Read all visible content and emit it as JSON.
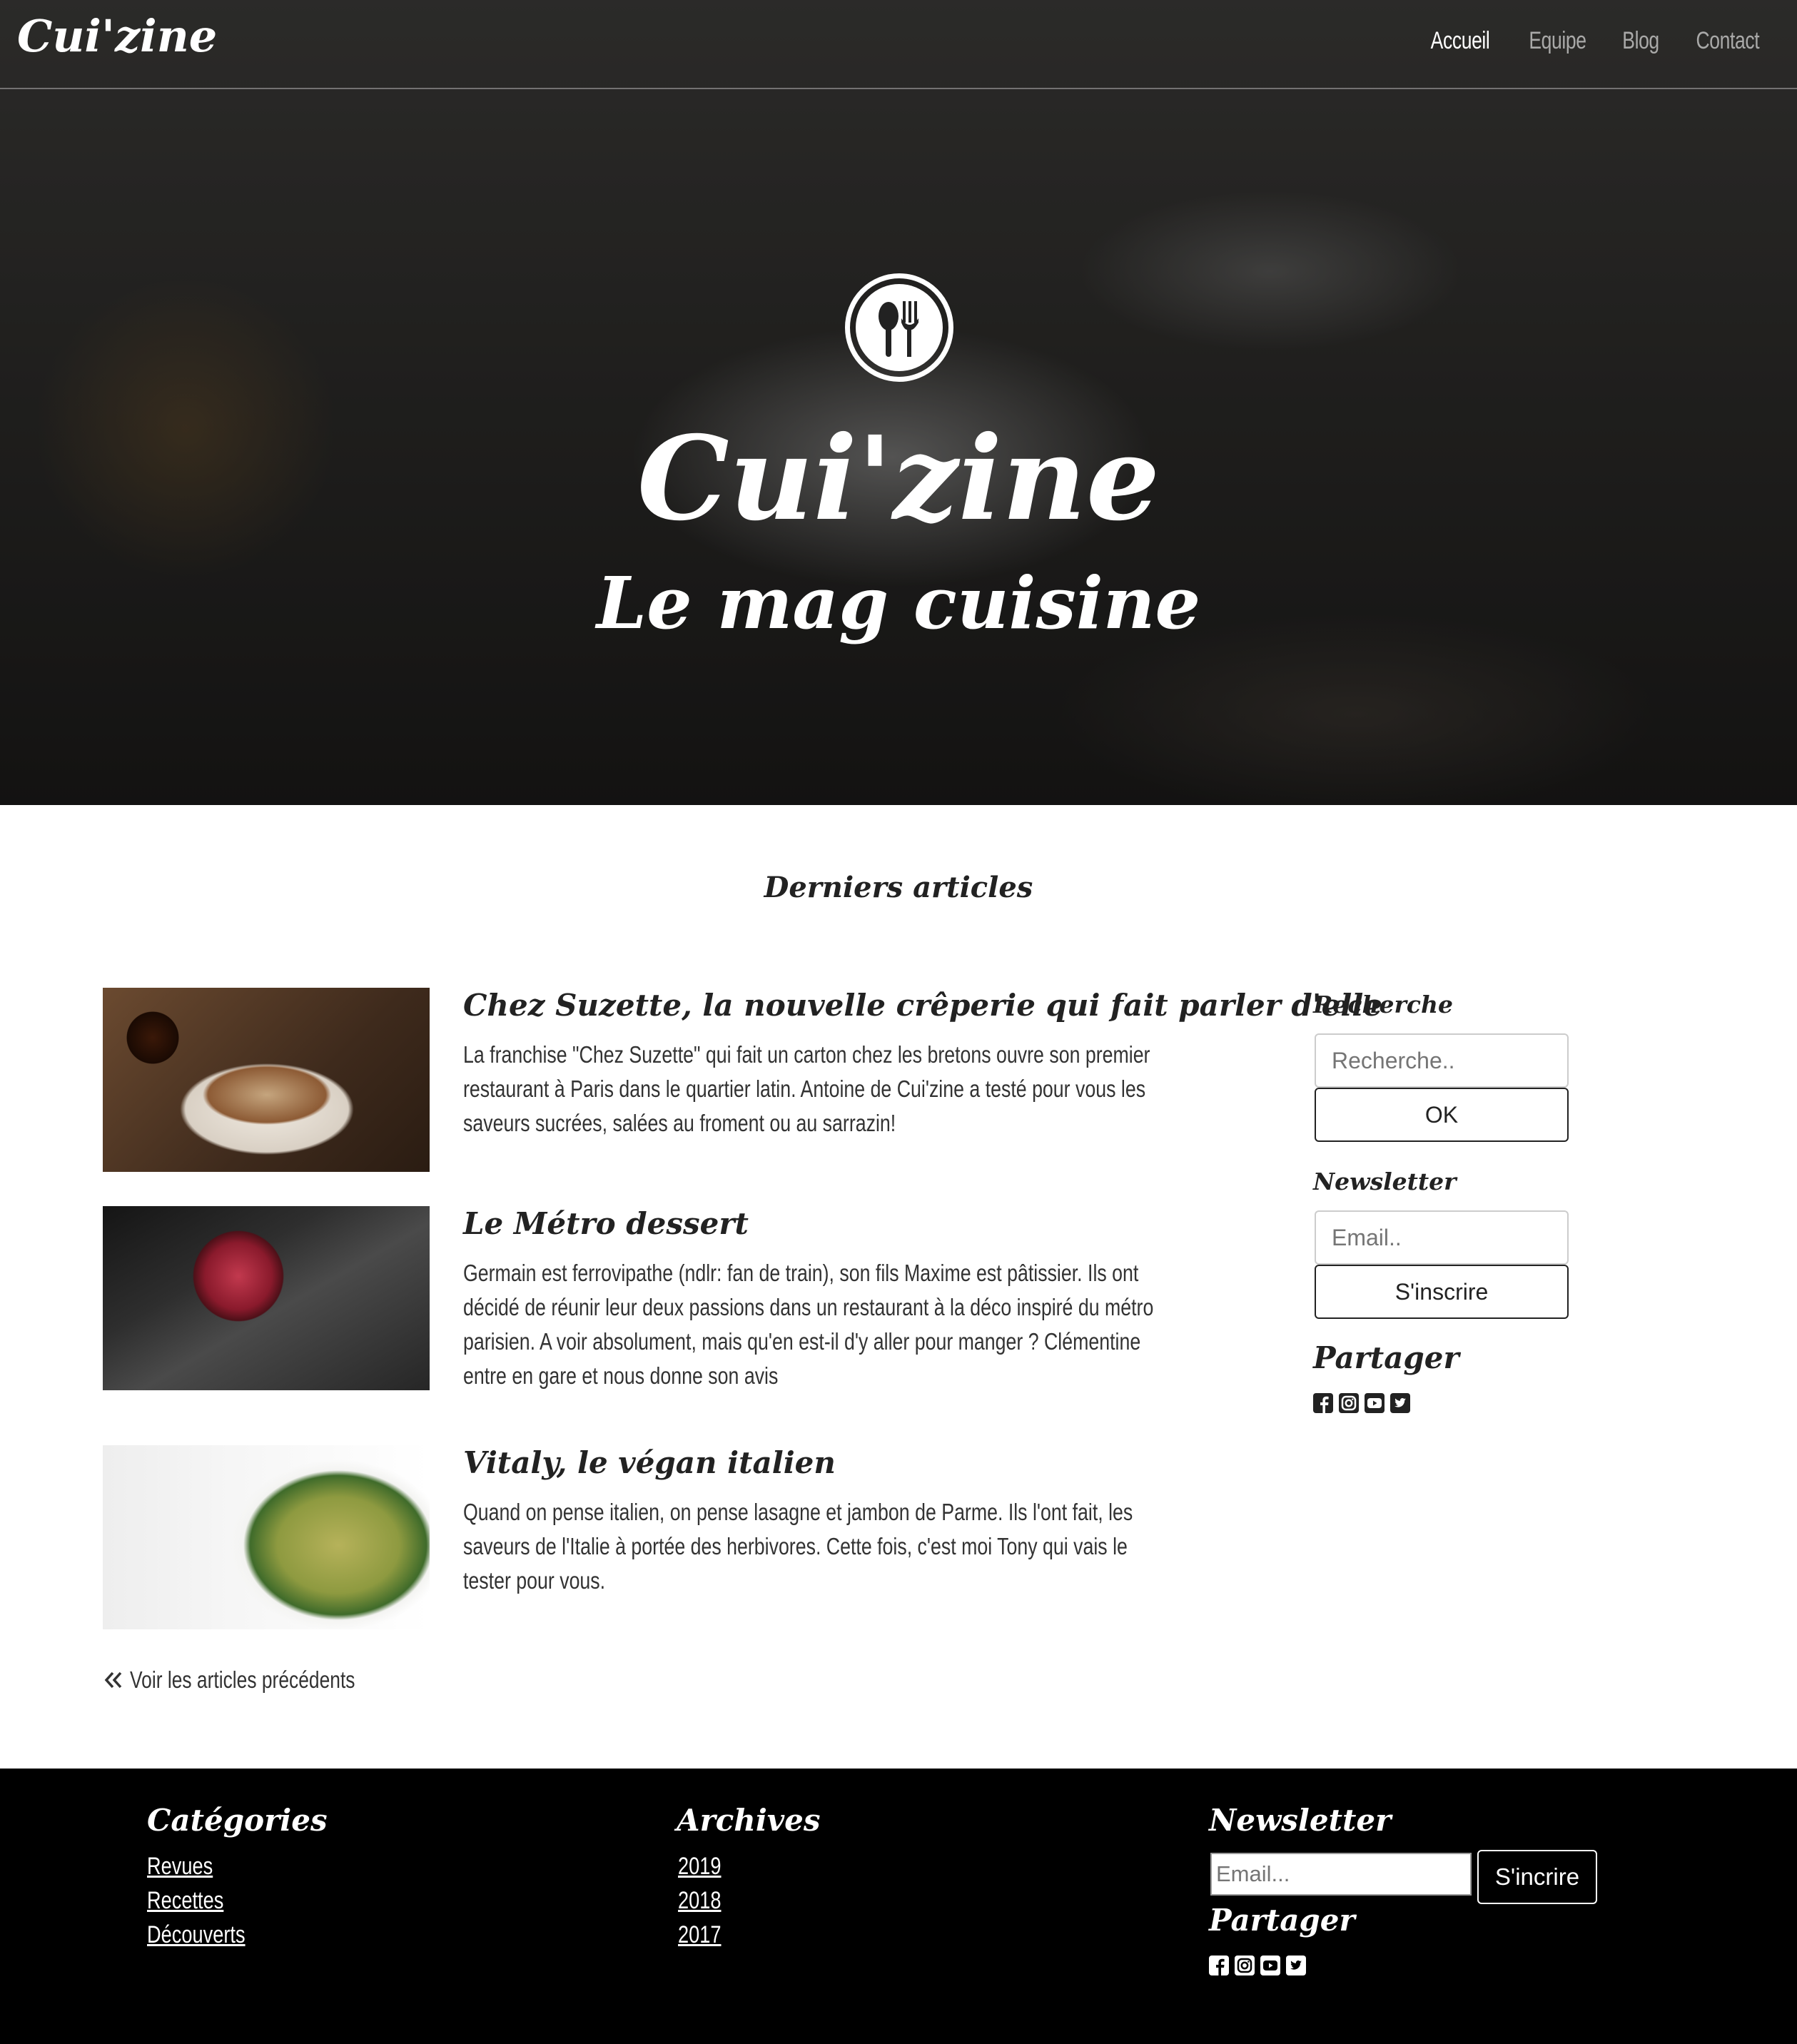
{
  "header": {
    "brand": "Cui'zine",
    "nav": [
      {
        "label": "Accueil",
        "active": true
      },
      {
        "label": "Equipe",
        "active": false
      },
      {
        "label": "Blog",
        "active": false
      },
      {
        "label": "Contact",
        "active": false
      }
    ]
  },
  "hero": {
    "logo_icon": "spoon-fork-icon",
    "title": "Cui'zine",
    "subtitle": "Le mag cuisine"
  },
  "main": {
    "section_title": "Derniers articles",
    "articles": [
      {
        "title": "Chez Suzette, la nouvelle crêperie qui fait parler d'elle",
        "text": "La franchise \"Chez Suzette\" qui fait un carton chez les bretons ouvre son premier restaurant à Paris dans le quartier latin. Antoine de Cui'zine a testé pour vous les saveurs sucrées, salées au froment ou au sarrazin!",
        "image": "pancakes-photo"
      },
      {
        "title": "Le Métro dessert",
        "text": "Germain est ferrovipathe (ndlr: fan de train), son fils Maxime est pâtissier. Ils ont décidé de réunir leur deux passions dans un restaurant à la déco inspiré du métro parisien. A voir absolument, mais qu'en est-il d'y aller pour manger ? Clémentine entre en gare et nous donne son avis",
        "image": "raspberries-photo"
      },
      {
        "title": "Vitaly, le végan italien",
        "text": "Quand on pense italien, on pense lasagne et jambon de Parme. Ils l'ont fait, les saveurs de l'Italie à portée des herbivores. Cette fois, c'est moi Tony qui vais le tester pour vous.",
        "image": "pasta-salad-photo"
      }
    ],
    "previous_link": "Voir les articles précédents"
  },
  "sidebar": {
    "search_heading": "Recherche",
    "search_placeholder": "Recherche..",
    "search_button": "OK",
    "newsletter_heading": "Newsletter",
    "email_placeholder": "Email..",
    "subscribe_button": "S'inscrire",
    "share_heading": "Partager",
    "share_icons": [
      "facebook-icon",
      "instagram-icon",
      "youtube-icon",
      "twitter-icon"
    ]
  },
  "footer": {
    "categories_heading": "Catégories",
    "categories": [
      "Revues",
      "Recettes",
      "Découverts"
    ],
    "archives_heading": "Archives",
    "archives": [
      "2019",
      "2018",
      "2017"
    ],
    "newsletter_heading": "Newsletter",
    "email_placeholder": "Email...",
    "subscribe_button": "S'incrire",
    "share_heading": "Partager",
    "share_icons": [
      "facebook-icon",
      "instagram-icon",
      "youtube-icon",
      "twitter-icon"
    ]
  },
  "colors": {
    "dark": "#000000",
    "text": "#222222",
    "nav_inactive": "rgba(255,255,255,0.6)"
  }
}
